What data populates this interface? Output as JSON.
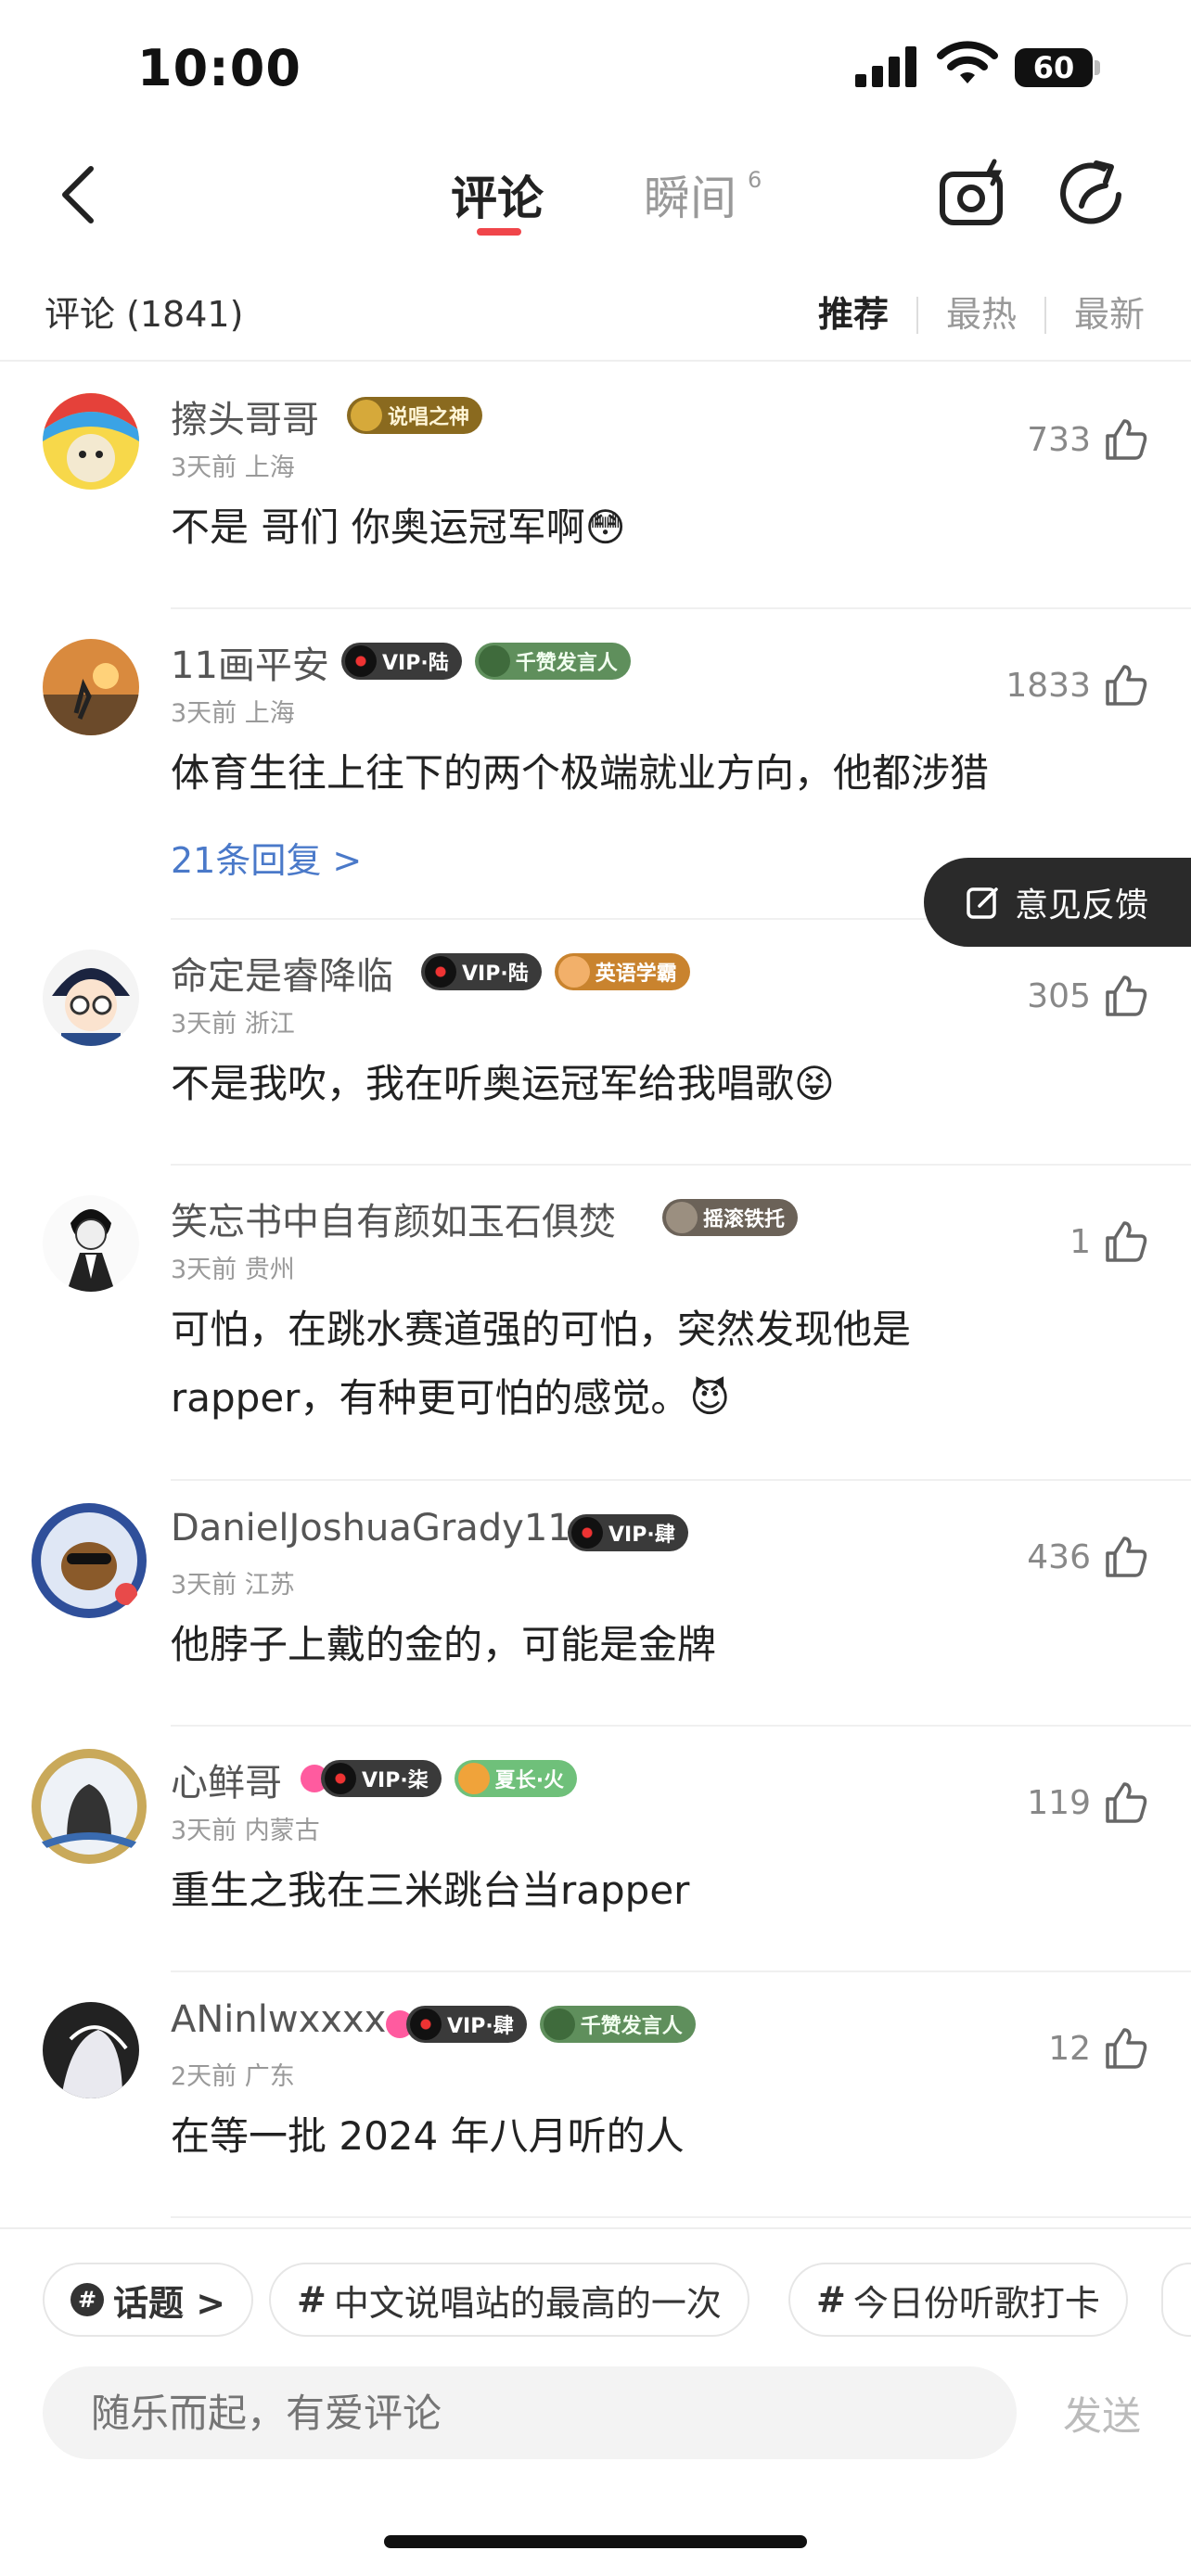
{
  "status_bar": {
    "time": "10:00",
    "battery": "60"
  },
  "nav": {
    "tab_comments": "评论",
    "tab_moments": "瞬间",
    "tab_moments_count": "6"
  },
  "header": {
    "count": "评论 (1841)",
    "sort": [
      "推荐",
      "最热",
      "最新"
    ]
  },
  "feedback": "意见反馈",
  "comments": [
    {
      "user": "擦头哥哥",
      "badges": [
        {
          "text": "说唱之神",
          "style": "gold"
        }
      ],
      "meta": "3天前 上海",
      "text": "不是 哥们 你奥运冠军啊😳",
      "likes": "733",
      "replies": ""
    },
    {
      "user": "11画平安",
      "badges": [
        {
          "text": "VIP·陆",
          "style": "vip"
        },
        {
          "text": "千赞发言人",
          "style": "green"
        }
      ],
      "meta": "3天前 上海",
      "text": "体育生往上往下的两个极端就业方向，他都涉猎",
      "likes": "1833",
      "replies": "21条回复 >"
    },
    {
      "user": "命定是睿降临",
      "badges": [
        {
          "text": "VIP·陆",
          "style": "vip"
        },
        {
          "text": "英语学霸",
          "style": "orange"
        }
      ],
      "meta": "3天前 浙江",
      "text": "不是我吹，我在听奥运冠军给我唱歌😝",
      "likes": "305",
      "replies": ""
    },
    {
      "user": "笑忘书中自有颜如玉石俱焚",
      "badges": [
        {
          "text": "摇滚铁托",
          "style": "gray"
        }
      ],
      "meta": "3天前 贵州",
      "text": "可怕，在跳水赛道强的可怕，突然发现他是 rapper，有种更可怕的感觉。😈",
      "likes": "1",
      "replies": ""
    },
    {
      "user": "DanielJoshuaGrady11",
      "badges": [
        {
          "text": "VIP·肆",
          "style": "vip"
        }
      ],
      "meta": "3天前 江苏",
      "text": "他脖子上戴的金的，可能是金牌",
      "likes": "436",
      "replies": ""
    },
    {
      "user": "心鲜哥",
      "badges": [
        {
          "text": "VIP·柒",
          "style": "vip"
        },
        {
          "text": "夏长·火",
          "style": "lgreen"
        }
      ],
      "meta": "3天前 内蒙古",
      "text": "重生之我在三米跳台当rapper",
      "likes": "119",
      "replies": ""
    },
    {
      "user": "ANinlwxxxx",
      "badges": [
        {
          "text": "VIP·肆",
          "style": "vip"
        },
        {
          "text": "千赞发言人",
          "style": "green"
        }
      ],
      "meta": "2天前 广东",
      "text": "在等一批 2024 年八月听的人",
      "likes": "12",
      "replies": ""
    }
  ],
  "topics": {
    "topic_label": "话题 >",
    "chip1": "中文说唱站的最高的一次",
    "chip2": "今日份听歌打卡"
  },
  "input": {
    "placeholder": "随乐而起，有爱评论",
    "send": "发送"
  }
}
